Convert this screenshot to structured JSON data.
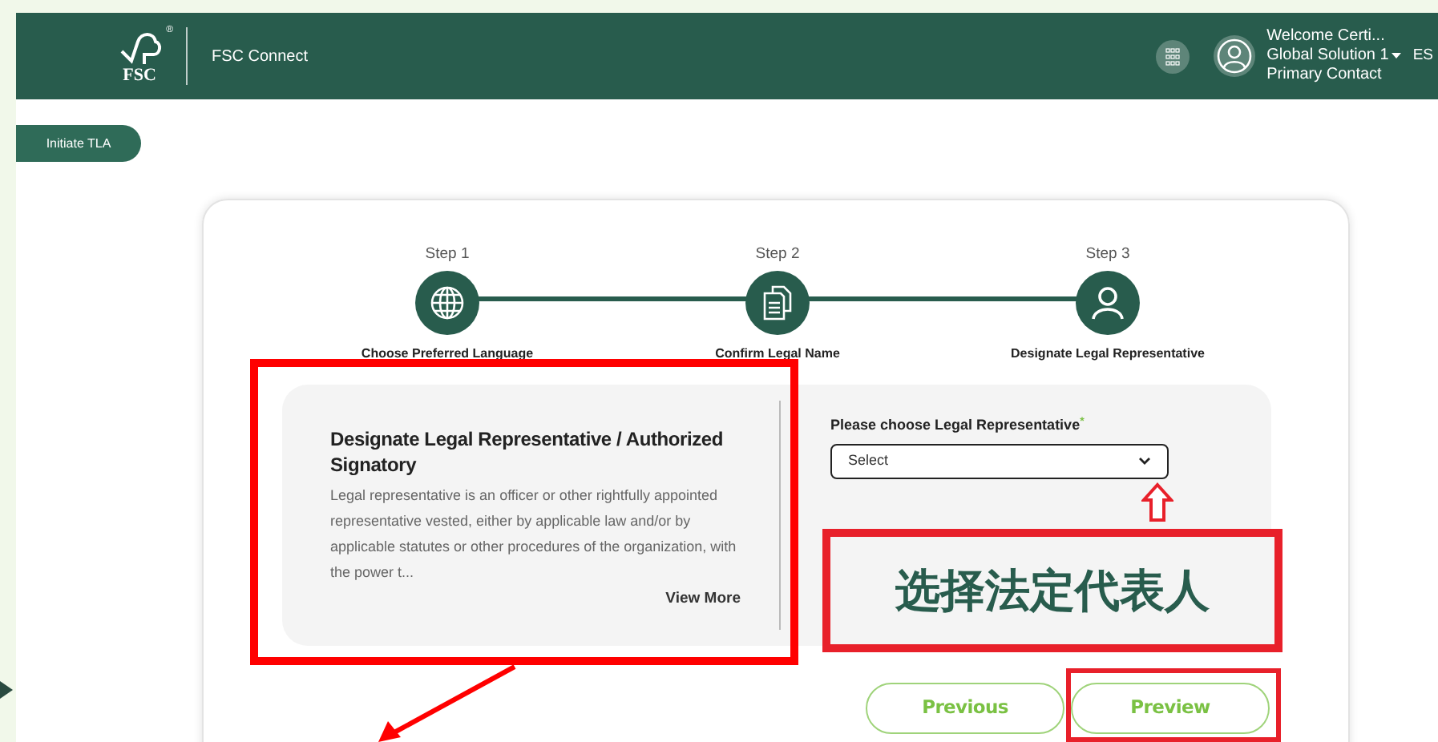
{
  "header": {
    "logo_text": "FSC",
    "logo_mark": "®",
    "app_name": "FSC Connect",
    "user": {
      "welcome": "Welcome Certi...",
      "organization": "Global Solution 1",
      "role": "Primary Contact"
    },
    "language": "ES"
  },
  "initiate_button": "Initiate TLA",
  "steps": [
    {
      "step": "Step 1",
      "label": "Choose Preferred Language",
      "kind": "globe"
    },
    {
      "step": "Step 2",
      "label": "Confirm Legal Name",
      "kind": "document"
    },
    {
      "step": "Step 3",
      "label": "Designate Legal Representative",
      "kind": "person"
    }
  ],
  "info_panel": {
    "title": "Designate Legal Representative / Authorized Signatory",
    "description": "Legal representative is an officer or other rightfully appointed representative vested, either by applicable law and/or by applicable statutes or other procedures of the organization, with the power t...",
    "view_more": "View More"
  },
  "form": {
    "label": "Please choose Legal Representative",
    "required_mark": "*",
    "select": {
      "placeholder": "Select"
    }
  },
  "buttons": [
    {
      "label": "Previous"
    },
    {
      "label": "Preview"
    }
  ],
  "annotations": {
    "callout": "选择法定代表人"
  }
}
